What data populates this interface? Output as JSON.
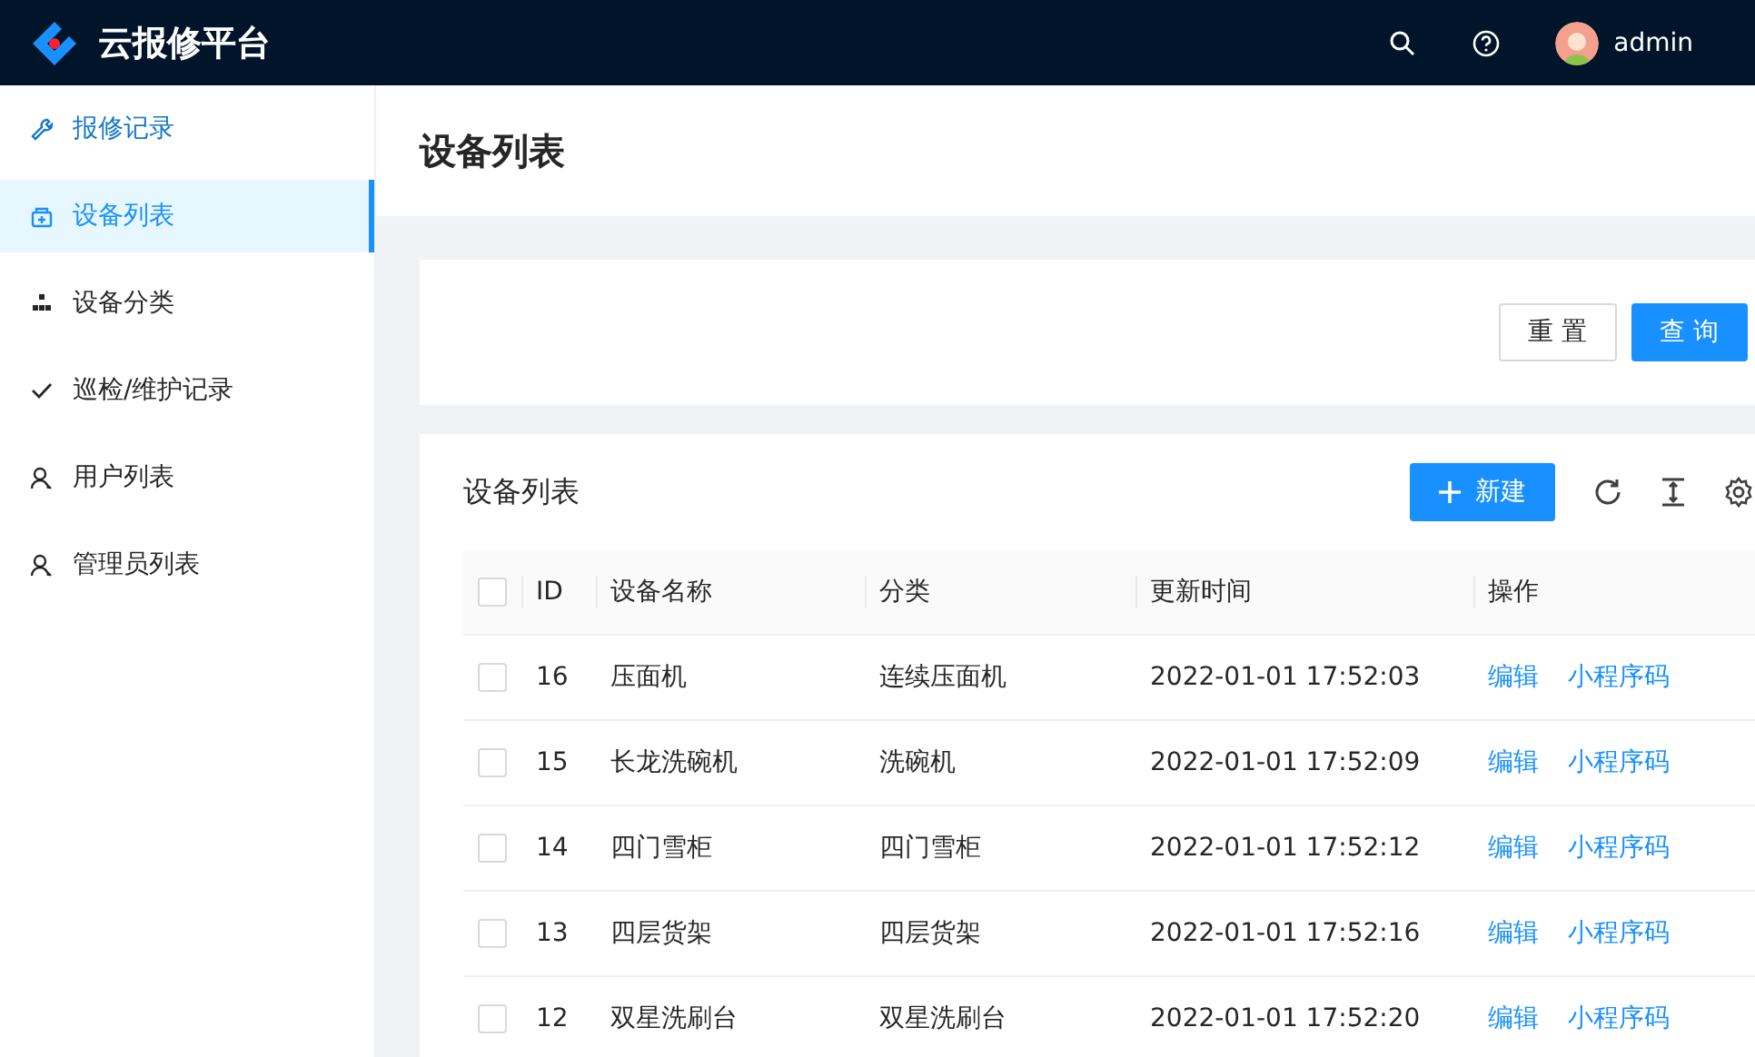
{
  "header": {
    "title": "云报修平台",
    "user": "admin"
  },
  "sidebar": {
    "items": [
      {
        "label": "报修记录",
        "kind": "wrench",
        "selected": false,
        "hovered": true
      },
      {
        "label": "设备列表",
        "kind": "box",
        "selected": true,
        "hovered": false
      },
      {
        "label": "设备分类",
        "kind": "tree",
        "selected": false,
        "hovered": false
      },
      {
        "label": "巡检/维护记录",
        "kind": "check",
        "selected": false,
        "hovered": false
      },
      {
        "label": "用户列表",
        "kind": "user",
        "selected": false,
        "hovered": false
      },
      {
        "label": "管理员列表",
        "kind": "user",
        "selected": false,
        "hovered": false
      }
    ]
  },
  "page_title": "设备列表",
  "search_form": {
    "buttons": [
      {
        "label": "重 置",
        "kind": "default"
      },
      {
        "label": "查 询",
        "kind": "primary"
      }
    ]
  },
  "table": {
    "title": "设备列表",
    "new_button": "新建",
    "select_all_checked": false,
    "columns": [
      "ID",
      "设备名称",
      "分类",
      "更新时间",
      "操作"
    ],
    "rows": [
      {
        "checked": false,
        "id": "16",
        "name": "压面机",
        "category": "连续压面机",
        "updated": "2022-01-01 17:52:03",
        "actions": [
          "编辑",
          "小程序码"
        ]
      },
      {
        "checked": false,
        "id": "15",
        "name": "长龙洗碗机",
        "category": "洗碗机",
        "updated": "2022-01-01 17:52:09",
        "actions": [
          "编辑",
          "小程序码"
        ]
      },
      {
        "checked": false,
        "id": "14",
        "name": "四门雪柜",
        "category": "四门雪柜",
        "updated": "2022-01-01 17:52:12",
        "actions": [
          "编辑",
          "小程序码"
        ]
      },
      {
        "checked": false,
        "id": "13",
        "name": "四层货架",
        "category": "四层货架",
        "updated": "2022-01-01 17:52:16",
        "actions": [
          "编辑",
          "小程序码"
        ]
      },
      {
        "checked": false,
        "id": "12",
        "name": "双星洗刷台",
        "category": "双星洗刷台",
        "updated": "2022-01-01 17:52:20",
        "actions": [
          "编辑",
          "小程序码"
        ]
      }
    ]
  }
}
